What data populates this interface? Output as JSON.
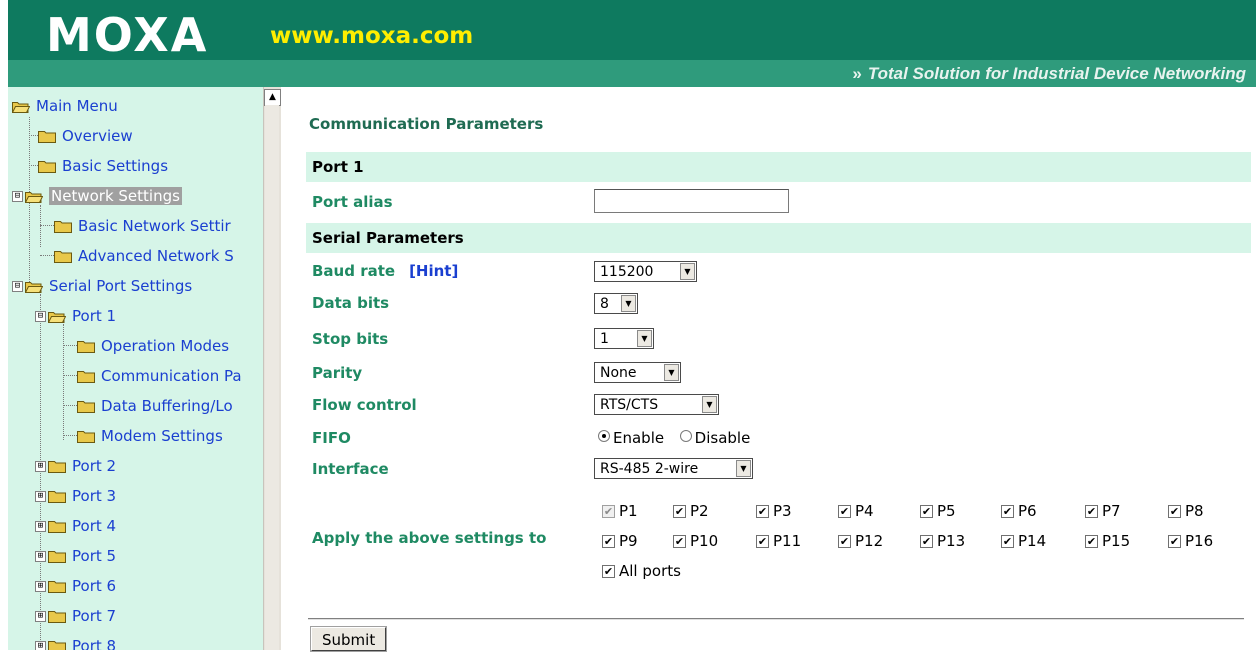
{
  "header": {
    "logo_text": "MOXA",
    "url": "www.moxa.com",
    "tagline": "Total Solution for Industrial Device Networking",
    "tagline_prefix": "»",
    "colors": {
      "dark": "#0e7a5f",
      "band": "#2f9b7c",
      "url": "#ffee00"
    }
  },
  "sidebar": {
    "items": [
      {
        "label": "Main Menu"
      },
      {
        "label": "Overview"
      },
      {
        "label": "Basic Settings"
      },
      {
        "label": "Network Settings",
        "expander": "⊟",
        "selected": true
      },
      {
        "label": "Basic Network Settir"
      },
      {
        "label": "Advanced Network S"
      },
      {
        "label": "Serial Port Settings",
        "expander": "⊟"
      },
      {
        "label": "Port 1",
        "expander": "⊟"
      },
      {
        "label": "Operation Modes"
      },
      {
        "label": "Communication Pa"
      },
      {
        "label": "Data Buffering/Lo"
      },
      {
        "label": "Modem Settings"
      },
      {
        "label": "Port 2",
        "expander": "⊞"
      },
      {
        "label": "Port 3",
        "expander": "⊞"
      },
      {
        "label": "Port 4",
        "expander": "⊞"
      },
      {
        "label": "Port 5",
        "expander": "⊞"
      },
      {
        "label": "Port 6",
        "expander": "⊞"
      },
      {
        "label": "Port 7",
        "expander": "⊞"
      },
      {
        "label": "Port 8",
        "expander": "⊞"
      }
    ]
  },
  "main": {
    "title": "Communication Parameters",
    "section_port": "Port 1",
    "port_alias_label": "Port alias",
    "port_alias_value": "",
    "section_serial": "Serial Parameters",
    "baud_label": "Baud rate",
    "hint_label": "[Hint]",
    "baud_value": "115200",
    "data_bits_label": "Data bits",
    "data_bits_value": "8",
    "stop_bits_label": "Stop bits",
    "stop_bits_value": "1",
    "parity_label": "Parity",
    "parity_value": "None",
    "flow_label": "Flow control",
    "flow_value": "RTS/CTS",
    "fifo_label": "FIFO",
    "fifo_enable": "Enable",
    "fifo_disable": "Disable",
    "fifo_selected": "Enable",
    "interface_label": "Interface",
    "interface_value": "RS-485 2-wire",
    "apply_label": "Apply the above settings to",
    "ports_row1": [
      "P1",
      "P2",
      "P3",
      "P4",
      "P5",
      "P6",
      "P7",
      "P8"
    ],
    "ports_row2": [
      "P9",
      "P10",
      "P11",
      "P12",
      "P13",
      "P14",
      "P15",
      "P16"
    ],
    "all_ports_label": "All ports",
    "submit_label": "Submit"
  }
}
